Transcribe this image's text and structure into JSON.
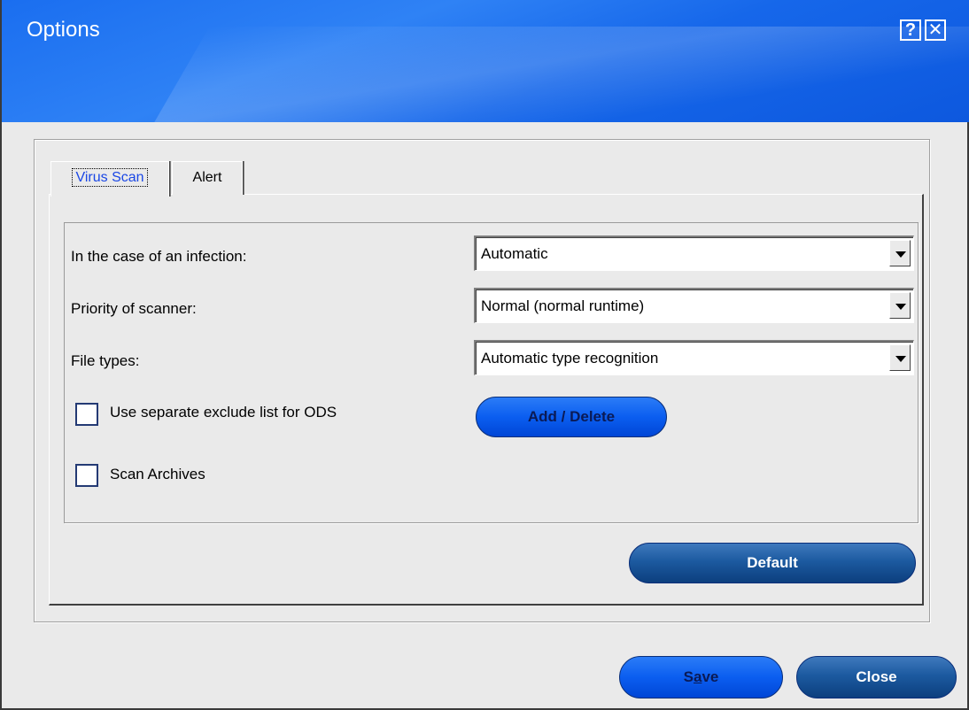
{
  "window": {
    "title": "Options",
    "help_icon_glyph": "?",
    "close_icon_glyph": "✕"
  },
  "tabs": [
    {
      "label": "Virus Scan",
      "active": true
    },
    {
      "label": "Alert",
      "active": false
    }
  ],
  "virus_scan": {
    "infection": {
      "label": "In the case of an infection:",
      "value": "Automatic"
    },
    "priority": {
      "label": "Priority of scanner:",
      "value": "Normal (normal runtime)"
    },
    "file_types": {
      "label": "File types:",
      "value": "Automatic type recognition"
    },
    "exclude_list": {
      "label": "Use separate exclude list for ODS",
      "checked": false
    },
    "add_delete_label": "Add / Delete",
    "scan_archives": {
      "label": "Scan Archives",
      "checked": false
    },
    "default_label": "Default"
  },
  "footer": {
    "save_label_prefix": "S",
    "save_label_key": "a",
    "save_label_suffix": "ve",
    "close_label": "Close"
  },
  "colors": {
    "titlebar": "#1a6ef0",
    "active_tab_text": "#1a47e5",
    "bright_button": "#0b5ef0",
    "dark_button": "#1c5aa0"
  }
}
